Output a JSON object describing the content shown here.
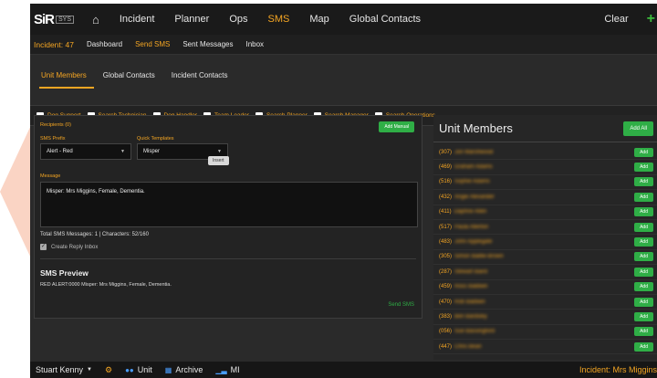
{
  "topnav": {
    "logo": "SiR",
    "logo_sub": "SYS",
    "items": [
      {
        "label": "Incident",
        "active": false
      },
      {
        "label": "Planner",
        "active": false
      },
      {
        "label": "Ops",
        "active": false
      },
      {
        "label": "SMS",
        "active": true
      },
      {
        "label": "Map",
        "active": false
      },
      {
        "label": "Global Contacts",
        "active": false
      }
    ],
    "clear_label": "Clear",
    "add_icon": "+"
  },
  "subnav": {
    "incident": "Incident: 47",
    "items": [
      {
        "label": "Dashboard",
        "active": false
      },
      {
        "label": "Send SMS",
        "active": true
      },
      {
        "label": "Sent Messages",
        "active": false
      },
      {
        "label": "Inbox",
        "active": false
      }
    ]
  },
  "tabs": [
    {
      "label": "Unit Members",
      "active": true
    },
    {
      "label": "Global Contacts",
      "active": false
    },
    {
      "label": "Incident Contacts",
      "active": false
    }
  ],
  "filters": [
    "Dog Support",
    "Search Technician",
    "Dog Handler",
    "Team Leader",
    "Search Planner",
    "Search Manager",
    "Search Operations"
  ],
  "compose": {
    "recipients_label": "Recipients (0)",
    "add_manual_label": "Add Manual",
    "prefix_label": "SMS Prefix",
    "prefix_value": "Alert - Red",
    "templates_label": "Quick Templates",
    "templates_value": "Misper",
    "insert_label": "Insert",
    "message_label": "Message",
    "message_value": "Misper: Mrs Miggins, Female, Dementia.",
    "totals": "Total SMS Messages: 1 | Characters: 52/160",
    "reply_label": "Create Reply Inbox",
    "preview_title": "SMS Preview",
    "preview_text": "RED ALERT:0000 Misper: Mrs Miggins, Female, Dementia.",
    "send_label": "Send SMS"
  },
  "members_panel": {
    "title": "Unit Members",
    "add_all_label": "Add All",
    "add_label": "Add",
    "members": [
      {
        "code": "(307)",
        "name": "Jon Marshwood"
      },
      {
        "code": "(469)",
        "name": "Graham Adams"
      },
      {
        "code": "(516)",
        "name": "Sophie Adams"
      },
      {
        "code": "(432)",
        "name": "Angie Alexander"
      },
      {
        "code": "(411)",
        "name": "Daphne Allen"
      },
      {
        "code": "(517)",
        "name": "Paula Allerton"
      },
      {
        "code": "(483)",
        "name": "John Applegate"
      },
      {
        "code": "(305)",
        "name": "Simon Baillie-Brown"
      },
      {
        "code": "(287)",
        "name": "Stewart Baird"
      },
      {
        "code": "(459)",
        "name": "Ross Baldwin"
      },
      {
        "code": "(470)",
        "name": "Rob Baldwin"
      },
      {
        "code": "(383)",
        "name": "Ben Bardsley"
      },
      {
        "code": "(056)",
        "name": "Sue Bassingford"
      },
      {
        "code": "(447)",
        "name": "Chris Bean"
      }
    ]
  },
  "bottombar": {
    "user": "Stuart Kenny",
    "unit": "Unit",
    "archive": "Archive",
    "mi": "MI",
    "incident": "Incident: Mrs Miggins"
  },
  "colors": {
    "accent": "#f5a623",
    "green": "#2fae46",
    "bg": "#2a2a2a"
  }
}
